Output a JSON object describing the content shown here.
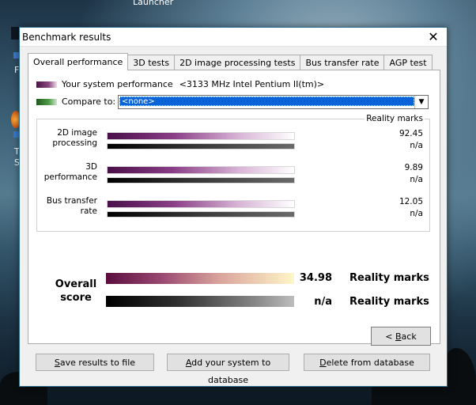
{
  "desktop": {
    "launcher_label": "Launcher",
    "icon_letter_1": "F",
    "icon_letter_2": "T",
    "icon_letter_3": "S"
  },
  "window": {
    "title": "Benchmark results",
    "close_symbol": "✕"
  },
  "tabs": [
    {
      "label": "Overall performance",
      "active": true
    },
    {
      "label": "3D tests",
      "active": false
    },
    {
      "label": "2D image processing tests",
      "active": false
    },
    {
      "label": "Bus transfer rate",
      "active": false
    },
    {
      "label": "AGP test",
      "active": false
    }
  ],
  "legend": {
    "system_label": "Your system performance",
    "system_value": "<3133 MHz Intel Pentium II(tm)>",
    "compare_label": "Compare to:",
    "compare_value": "<none>",
    "system_color": "#6b2466",
    "compare_color": "#2f7a2a"
  },
  "results": {
    "caption": "Reality marks",
    "metrics": [
      {
        "label_line1": "2D image",
        "label_line2": "processing",
        "system_value": "92.45",
        "compare_value": "n/a"
      },
      {
        "label_line1": "3D",
        "label_line2": "performance",
        "system_value": "9.89",
        "compare_value": "n/a"
      },
      {
        "label_line1": "Bus transfer",
        "label_line2": "rate",
        "system_value": "12.05",
        "compare_value": "n/a"
      }
    ]
  },
  "overall": {
    "label_line1": "Overall",
    "label_line2": "score",
    "system_value": "34.98",
    "compare_value": "n/a",
    "unit": "Reality marks"
  },
  "buttons": {
    "back_pre": "< ",
    "back_ul": "B",
    "back_post": "ack",
    "save_ul": "S",
    "save_post": "ave results to file",
    "add_ul": "A",
    "add_post": "dd your system to database",
    "delete_ul": "D",
    "delete_post": "elete from database"
  }
}
